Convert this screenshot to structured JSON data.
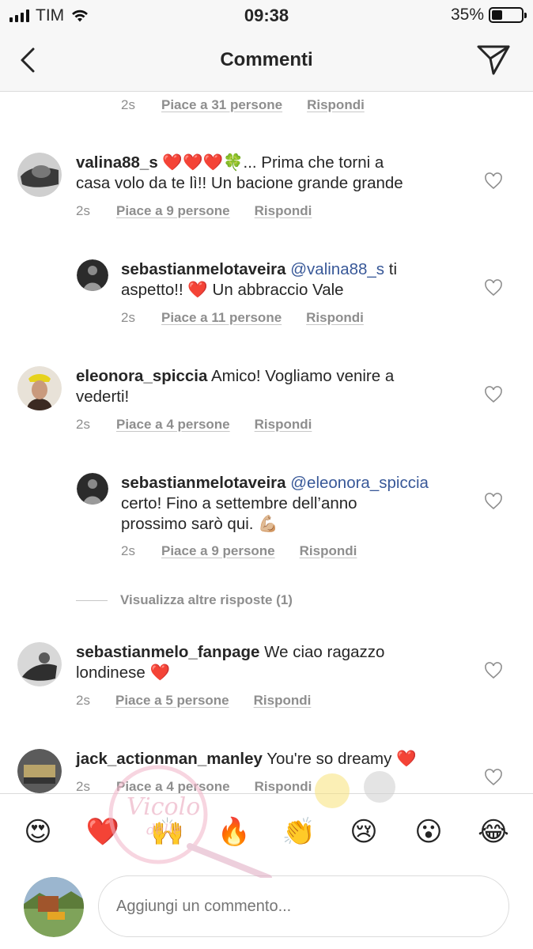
{
  "status": {
    "carrier": "TIM",
    "time": "09:38",
    "battery": "35%",
    "battery_level": 0.35
  },
  "header": {
    "title": "Commenti",
    "back_icon": "chevron-left-icon",
    "send_icon": "paper-plane-icon"
  },
  "comments": [
    {
      "time": "2s",
      "likes": "Piace a 31 persone",
      "reply": "Rispondi"
    },
    {
      "user": "valina88_s",
      "line1": " ❤️❤️❤️🍀... Prima che torni a",
      "line2": "casa volo da te lì!! Un bacione grande grande",
      "time": "2s",
      "likes": "Piace a 9 persone",
      "reply": "Rispondi"
    },
    {
      "user": "sebastianmelotaveira",
      "mention": "@valina88_s",
      "line1": " ti",
      "line2": "aspetto!! ❤️ Un abbraccio Vale",
      "time": "2s",
      "likes": "Piace a 11 persone",
      "reply": "Rispondi"
    },
    {
      "user": "eleonora_spiccia",
      "line1": " Amico! Vogliamo venire a",
      "line2": "vederti!",
      "time": "2s",
      "likes": "Piace a 4 persone",
      "reply": "Rispondi"
    },
    {
      "user": "sebastianmelotaveira",
      "mention": "@eleonora_spiccia",
      "line2": "certo! Fino a settembre dell’anno",
      "line3": "prossimo sarò qui. 💪🏼",
      "time": "2s",
      "likes": "Piace a 9 persone",
      "reply": "Rispondi"
    },
    {
      "user": "sebastianmelo_fanpage",
      "line1": " We ciao ragazzo",
      "line2": "londinese ❤️",
      "time": "2s",
      "likes": "Piace a 5 persone",
      "reply": "Rispondi"
    },
    {
      "user": "jack_actionman_manley",
      "line1": " You're so dreamy ❤️",
      "time": "2s",
      "likes": "Piace a 4 persone",
      "reply": "Rispondi"
    }
  ],
  "more_replies": "Visualizza altre risposte (1)",
  "emoji_bar": [
    "😍",
    "❤️",
    "🙌",
    "🔥",
    "👏",
    "😢",
    "😮",
    "😂"
  ],
  "input": {
    "placeholder": "Aggiungi un commento..."
  },
  "colors": {
    "mention": "#385898",
    "meta": "#8e8e8e",
    "heart_red": "#e8262c"
  }
}
